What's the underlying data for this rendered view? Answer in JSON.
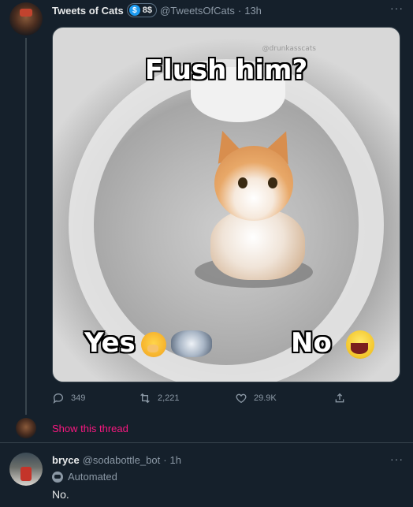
{
  "tweet": {
    "display_name": "Tweets of Cats",
    "badge_label": "8$",
    "badge_icon": "dollar-icon",
    "handle": "@TweetsOfCats",
    "separator": "·",
    "time": "13h",
    "more_label": "···",
    "media": {
      "caption_top": "Flush him?",
      "watermark": "@drunkasscats",
      "option_yes": "Yes",
      "option_no": "No"
    },
    "actions": {
      "replies": "349",
      "retweets": "2,221",
      "likes": "29.9K"
    }
  },
  "thread": {
    "show_thread_label": "Show this thread",
    "accent_color": "#f91880"
  },
  "reply": {
    "display_name": "bryce",
    "handle": "@sodabottle_bot",
    "separator": "·",
    "time": "1h",
    "automated_label": "Automated",
    "text": "No.",
    "more_label": "···"
  },
  "theme": {
    "background": "#15202b",
    "border": "#38444d",
    "muted_text": "#8b98a5",
    "accent_blue": "#1d9bf0"
  }
}
